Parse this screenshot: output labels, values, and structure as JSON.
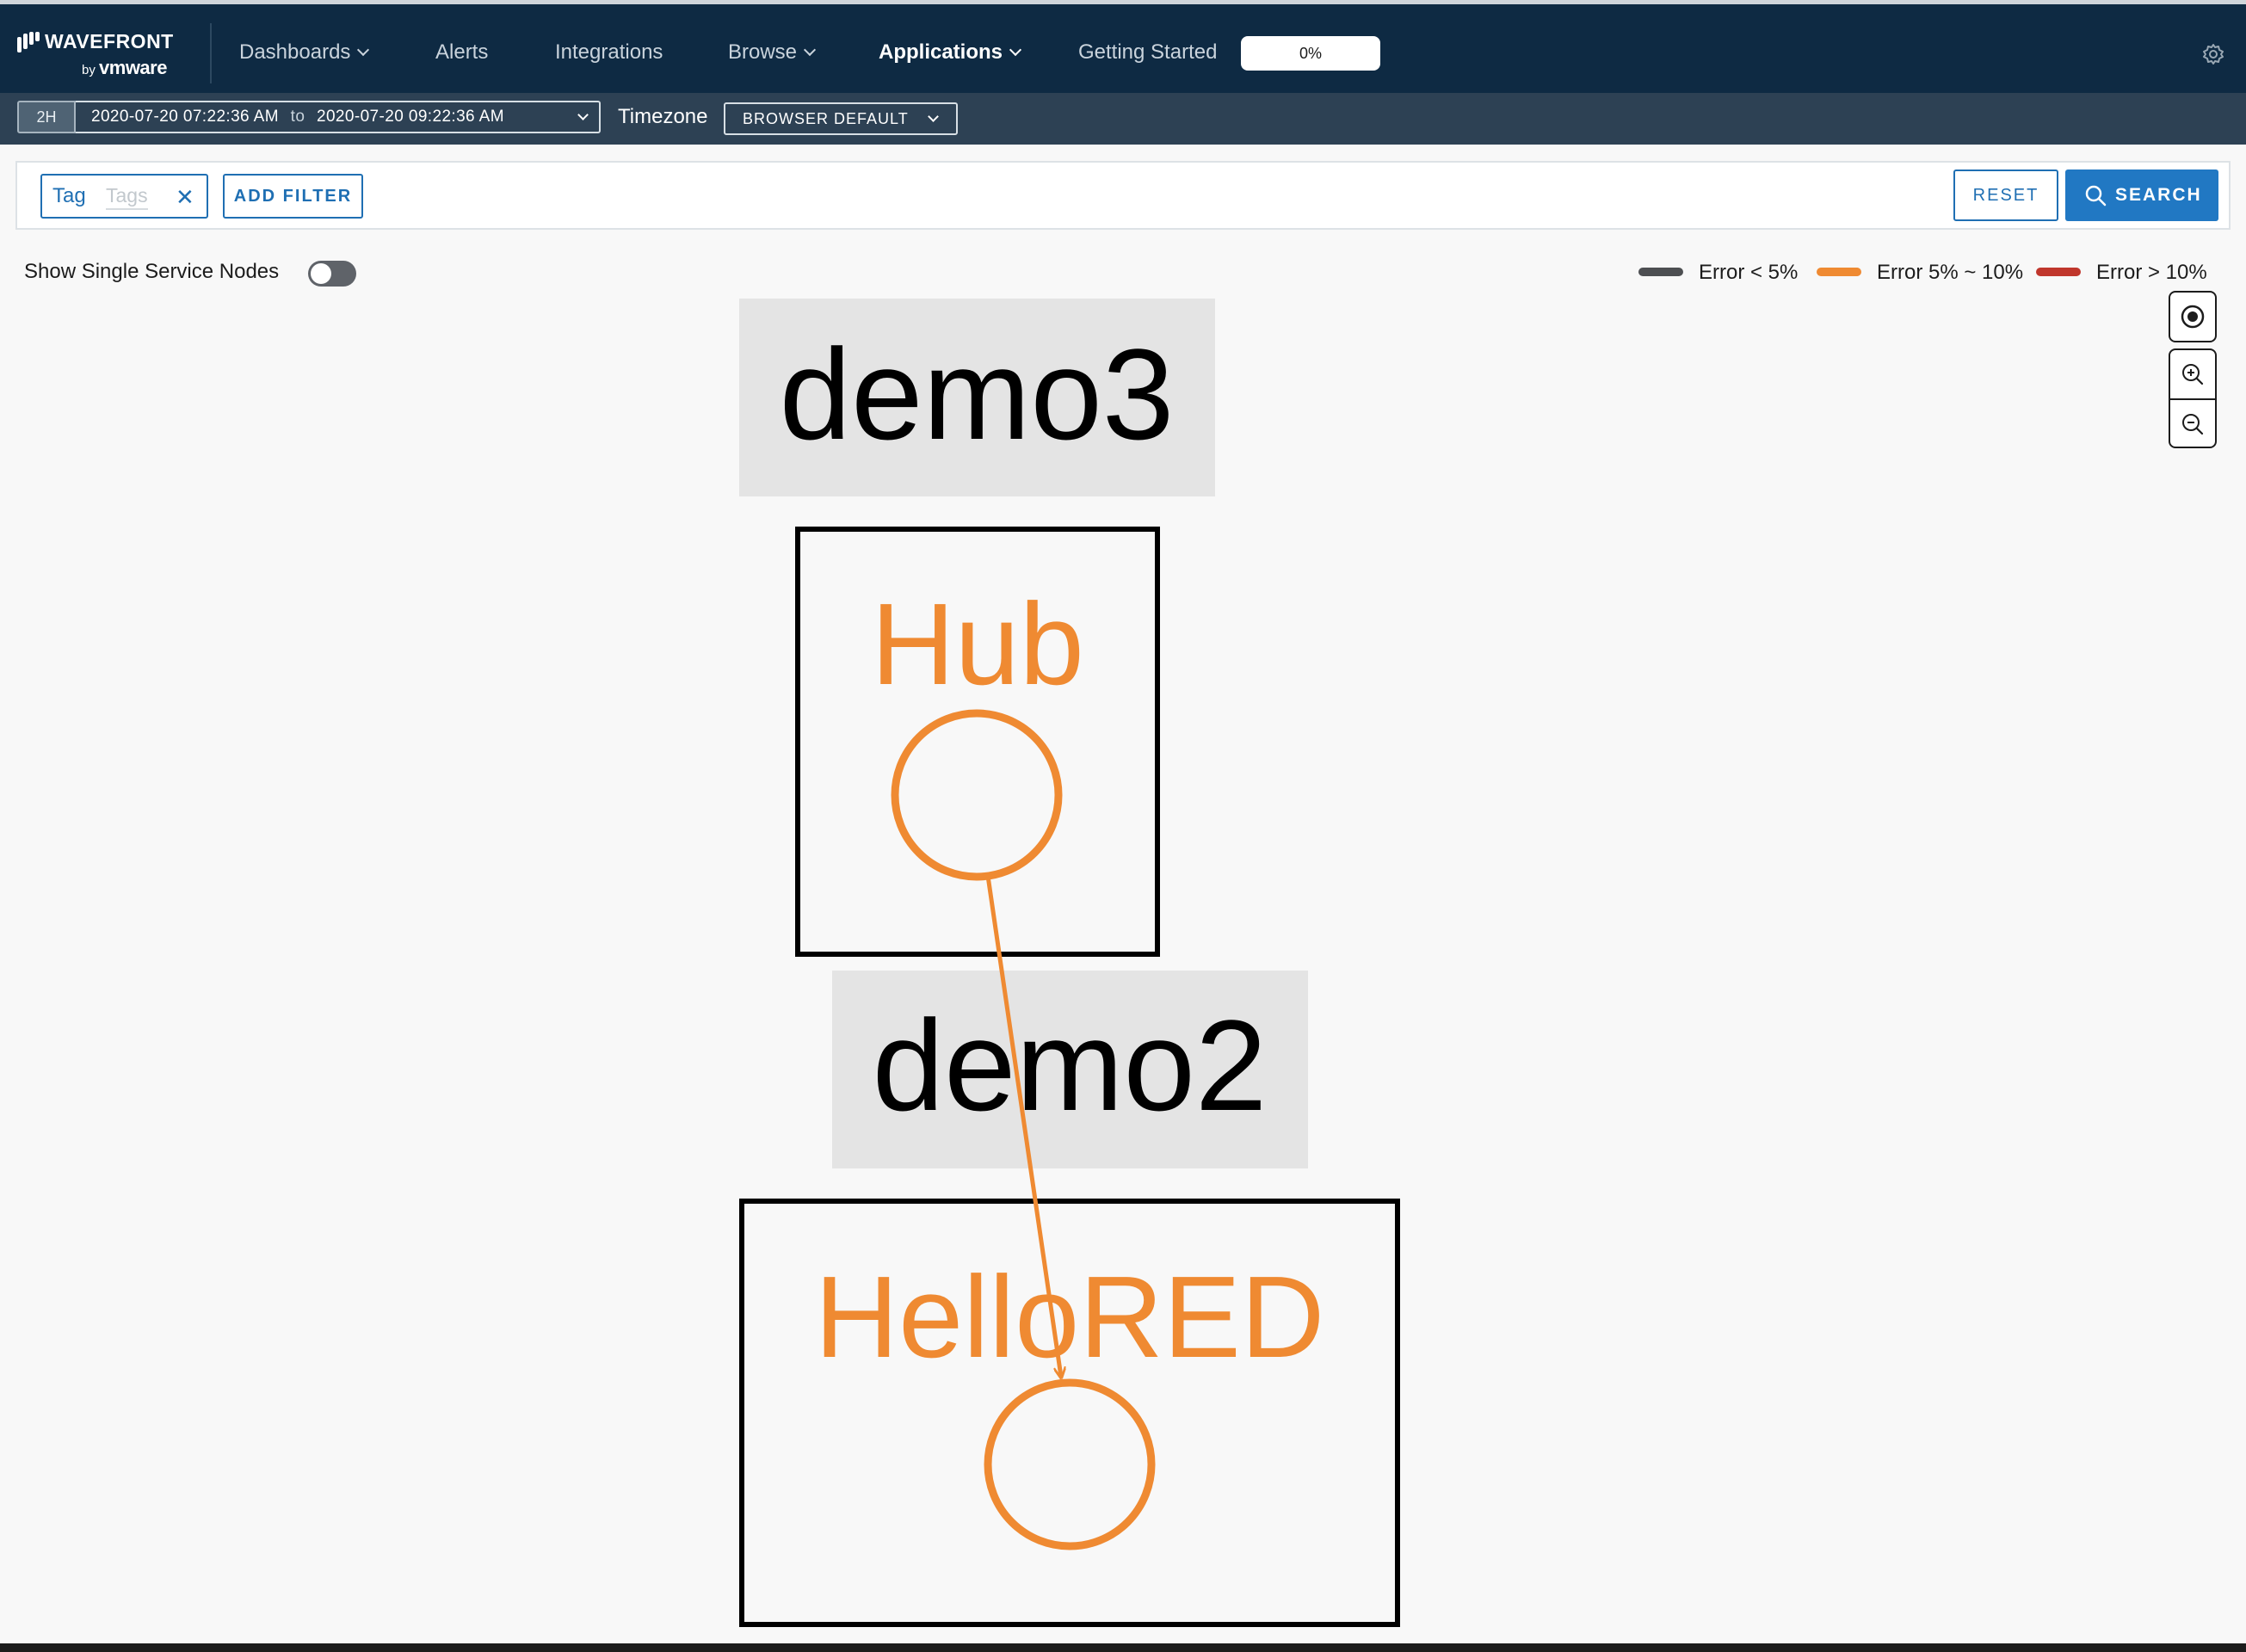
{
  "brand": {
    "title": "WAVEFRONT",
    "by": "by",
    "company": "vmware"
  },
  "nav": {
    "dashboards": "Dashboards",
    "alerts": "Alerts",
    "integrations": "Integrations",
    "browse": "Browse",
    "applications": "Applications",
    "getting_started": "Getting Started",
    "progress": "0%"
  },
  "timebar": {
    "range": "2H",
    "start": "2020-07-20 07:22:36 AM",
    "to": "to",
    "end": "2020-07-20 09:22:36 AM",
    "timezone_label": "Timezone",
    "timezone_value": "BROWSER DEFAULT"
  },
  "filter": {
    "tag_key": "Tag",
    "tag_placeholder": "Tags",
    "add_filter": "ADD FILTER",
    "reset": "RESET",
    "search": "SEARCH"
  },
  "options": {
    "single_service_nodes": "Show Single Service Nodes"
  },
  "legend": [
    {
      "label": "Error < 5%",
      "color": "#4d4f52"
    },
    {
      "label": "Error 5% ~ 10%",
      "color": "#ef8a32"
    },
    {
      "label": "Error > 10%",
      "color": "#c0362c"
    }
  ],
  "graph": {
    "applications": [
      {
        "name": "demo3",
        "services": [
          {
            "name": "Hub",
            "status_color": "#ef8a32"
          }
        ]
      },
      {
        "name": "demo2",
        "services": [
          {
            "name": "HelloRED",
            "status_color": "#ef8a32"
          }
        ]
      }
    ],
    "edges": [
      {
        "from": "Hub",
        "to": "HelloRED",
        "color": "#ef8a32"
      }
    ]
  },
  "colors": {
    "nav_bg": "#0e2a43",
    "timebar_bg": "#2d4154",
    "accent": "#2178c3",
    "link": "#1f6fb3",
    "warning": "#ef8a32"
  }
}
